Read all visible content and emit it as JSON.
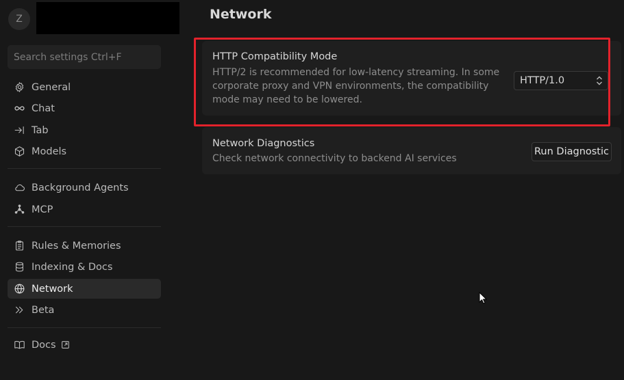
{
  "profile": {
    "avatar_letter": "Z"
  },
  "search": {
    "placeholder": "Search settings Ctrl+F"
  },
  "nav": {
    "groups": [
      [
        {
          "label": "General",
          "icon": "gear-icon"
        },
        {
          "label": "Chat",
          "icon": "infinity-icon"
        },
        {
          "label": "Tab",
          "icon": "tab-arrow-icon"
        },
        {
          "label": "Models",
          "icon": "cube-icon"
        }
      ],
      [
        {
          "label": "Background Agents",
          "icon": "cloud-icon"
        },
        {
          "label": "MCP",
          "icon": "nodes-icon"
        }
      ],
      [
        {
          "label": "Rules & Memories",
          "icon": "clipboard-icon"
        },
        {
          "label": "Indexing & Docs",
          "icon": "database-icon"
        },
        {
          "label": "Network",
          "icon": "globe-icon",
          "active": true
        },
        {
          "label": "Beta",
          "icon": "double-chevron-icon"
        }
      ],
      [
        {
          "label": "Docs",
          "icon": "book-icon",
          "external": true
        }
      ]
    ]
  },
  "main": {
    "title": "Network",
    "settings": [
      {
        "title": "HTTP Compatibility Mode",
        "desc_lines": [
          "HTTP/2 is recommended for low-latency streaming. In some",
          "corporate proxy and VPN environments, the compatibility",
          "mode may need to be lowered."
        ],
        "select_value": "HTTP/1.0"
      },
      {
        "title": "Network Diagnostics",
        "desc_lines": [
          "Check network connectivity to backend AI services"
        ],
        "button_label": "Run Diagnostic"
      }
    ]
  },
  "colors": {
    "highlight": "#e3222b",
    "background": "#181818",
    "card": "#1f1f1f"
  }
}
